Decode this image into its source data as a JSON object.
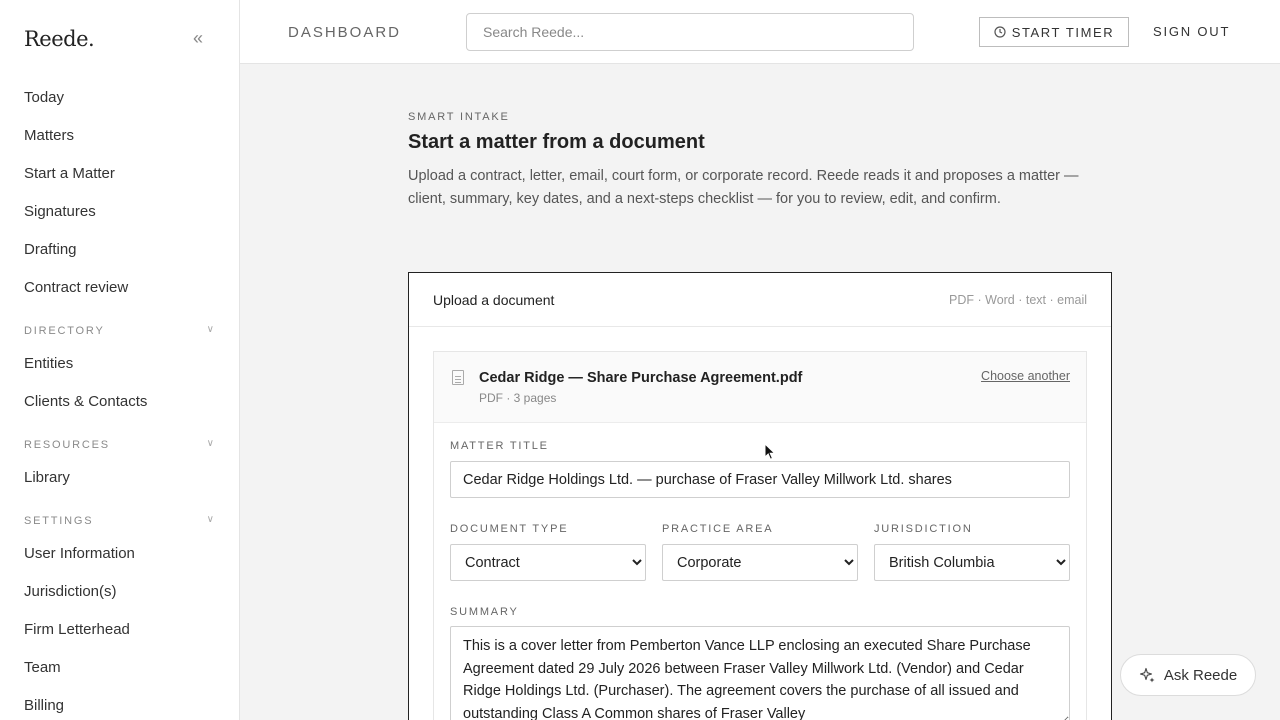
{
  "sidebar": {
    "brand": "Reede.",
    "collapse_icon": "«",
    "nav": [
      "Today",
      "Matters",
      "Start a Matter",
      "Signatures",
      "Drafting",
      "Contract review"
    ],
    "sections": [
      {
        "title": "DIRECTORY",
        "items": [
          "Entities",
          "Clients & Contacts"
        ]
      },
      {
        "title": "RESOURCES",
        "items": [
          "Library"
        ]
      },
      {
        "title": "SETTINGS",
        "items": [
          "User Information",
          "Jurisdiction(s)",
          "Firm Letterhead",
          "Team",
          "Billing"
        ]
      }
    ]
  },
  "topbar": {
    "breadcrumb": "DASHBOARD",
    "search_placeholder": "Search Reede...",
    "timer_label": "START TIMER",
    "signout_label": "SIGN OUT"
  },
  "main": {
    "eyebrow": "SMART INTAKE",
    "title": "Start a matter from a document",
    "intro": "Upload a contract, letter, email, court form, or corporate record. Reede reads it and proposes a matter — client, summary, key dates, and a next-steps checklist — for you to review, edit, and confirm."
  },
  "upload": {
    "title": "Upload a document",
    "formats": "PDF · Word · text · email",
    "file_name": "Cedar Ridge — Share Purchase Agreement.pdf",
    "file_meta": "PDF · 3 pages",
    "choose_another": "Choose another"
  },
  "form": {
    "matter_title_label": "MATTER TITLE",
    "matter_title_value": "Cedar Ridge Holdings Ltd. — purchase of Fraser Valley Millwork Ltd. shares",
    "doc_type_label": "DOCUMENT TYPE",
    "doc_type_value": "Contract",
    "practice_area_label": "PRACTICE AREA",
    "practice_area_value": "Corporate",
    "jurisdiction_label": "JURISDICTION",
    "jurisdiction_value": "British Columbia",
    "summary_label": "SUMMARY",
    "summary_value": "This is a cover letter from Pemberton Vance LLP enclosing an executed Share Purchase Agreement dated 29 July 2026 between Fraser Valley Millwork Ltd. (Vendor) and Cedar Ridge Holdings Ltd. (Purchaser). The agreement covers the purchase of all issued and outstanding Class A Common shares of Fraser Valley"
  },
  "assistant": {
    "label": "Ask Reede"
  }
}
